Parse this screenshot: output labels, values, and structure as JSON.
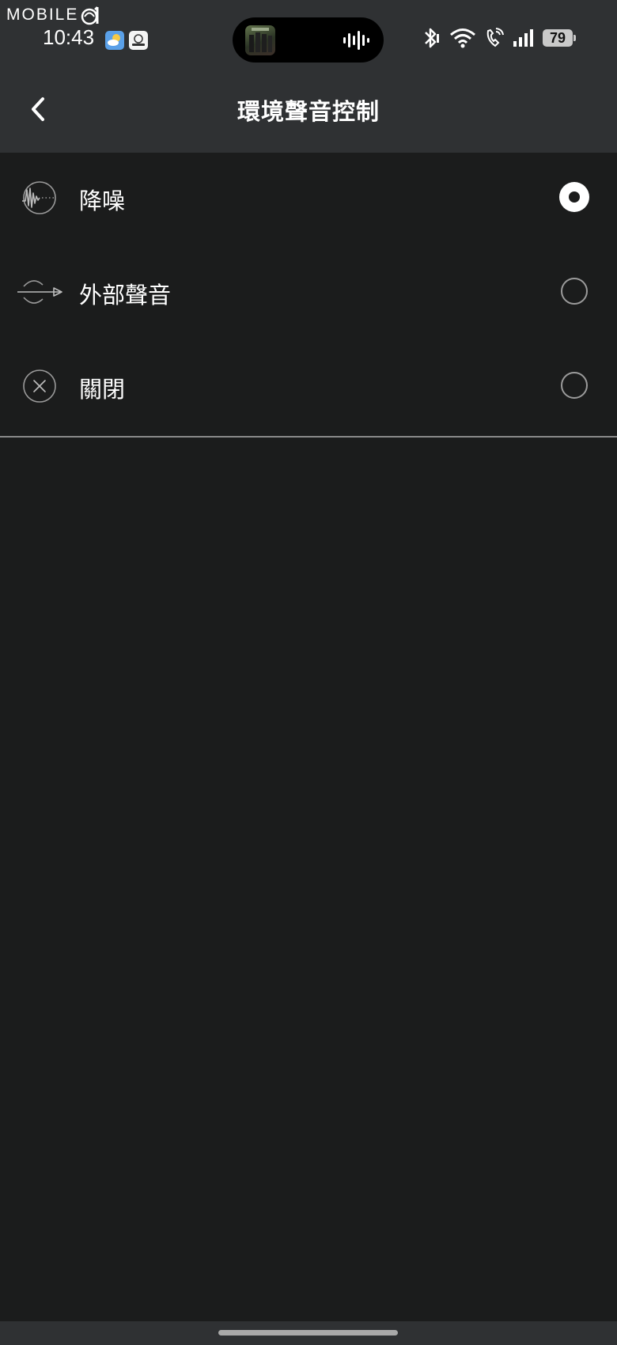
{
  "watermark": {
    "text": "MOBILE",
    "logo_icon": "mobile01-logo-icon"
  },
  "status_bar": {
    "time": "10:43",
    "left_icons": [
      "weather-app-icon",
      "assistant-app-icon"
    ],
    "right_icons": [
      "bluetooth-icon",
      "wifi-icon",
      "wifi-calling-icon",
      "cellular-signal-icon"
    ],
    "battery_level": "79"
  },
  "media_island": {
    "album_art": "album-art-icon",
    "activity": "audio-waveform-icon"
  },
  "header": {
    "back_icon": "chevron-left-icon",
    "title": "環境聲音控制"
  },
  "options": [
    {
      "label": "降噪",
      "icon": "noise-cancelling-icon",
      "selected": true
    },
    {
      "label": "外部聲音",
      "icon": "ambient-sound-icon",
      "selected": false
    },
    {
      "label": "關閉",
      "icon": "close-circle-icon",
      "selected": false
    }
  ],
  "colors": {
    "background": "#1b1c1c",
    "header_background": "#2f3133",
    "text": "#ffffff",
    "radio_border": "#9b9b9b"
  }
}
